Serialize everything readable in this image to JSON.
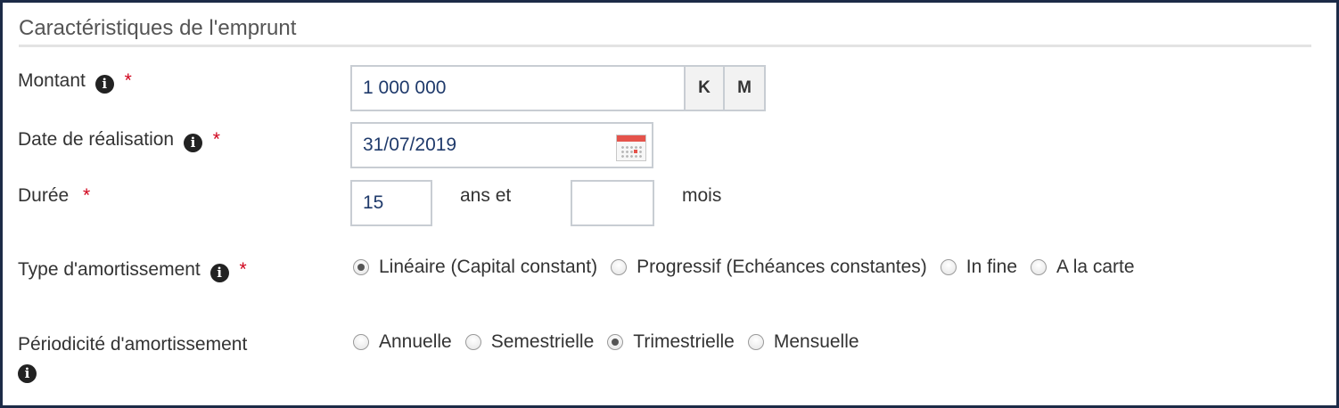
{
  "section": {
    "title": "Caractéristiques de l'emprunt"
  },
  "montant": {
    "label": "Montant",
    "value": "1 000 000",
    "buttons": [
      "K",
      "M"
    ],
    "info_icon": "info-circle-icon"
  },
  "date": {
    "label": "Date de réalisation",
    "value": "31/07/2019",
    "info_icon": "info-circle-icon",
    "calendar_icon": "calendar-icon"
  },
  "duree": {
    "label": "Durée",
    "years_value": "15",
    "years_unit": "ans et",
    "months_value": "",
    "months_unit": "mois"
  },
  "type_amortissement": {
    "label": "Type d'amortissement",
    "options": [
      {
        "label": "Linéaire (Capital constant)",
        "checked": true
      },
      {
        "label": "Progressif (Echéances constantes)",
        "checked": false
      },
      {
        "label": "In fine",
        "checked": false
      },
      {
        "label": "A la carte",
        "checked": false
      }
    ]
  },
  "periodicite": {
    "label": "Périodicité d'amortissement",
    "options": [
      {
        "label": "Annuelle",
        "checked": false
      },
      {
        "label": "Semestrielle",
        "checked": false
      },
      {
        "label": "Trimestrielle",
        "checked": true
      },
      {
        "label": "Mensuelle",
        "checked": false
      }
    ]
  },
  "required_marker": "*",
  "colors": {
    "required": "#d0021b",
    "input_text": "#1f3a6b",
    "frame": "#1c2b47"
  }
}
